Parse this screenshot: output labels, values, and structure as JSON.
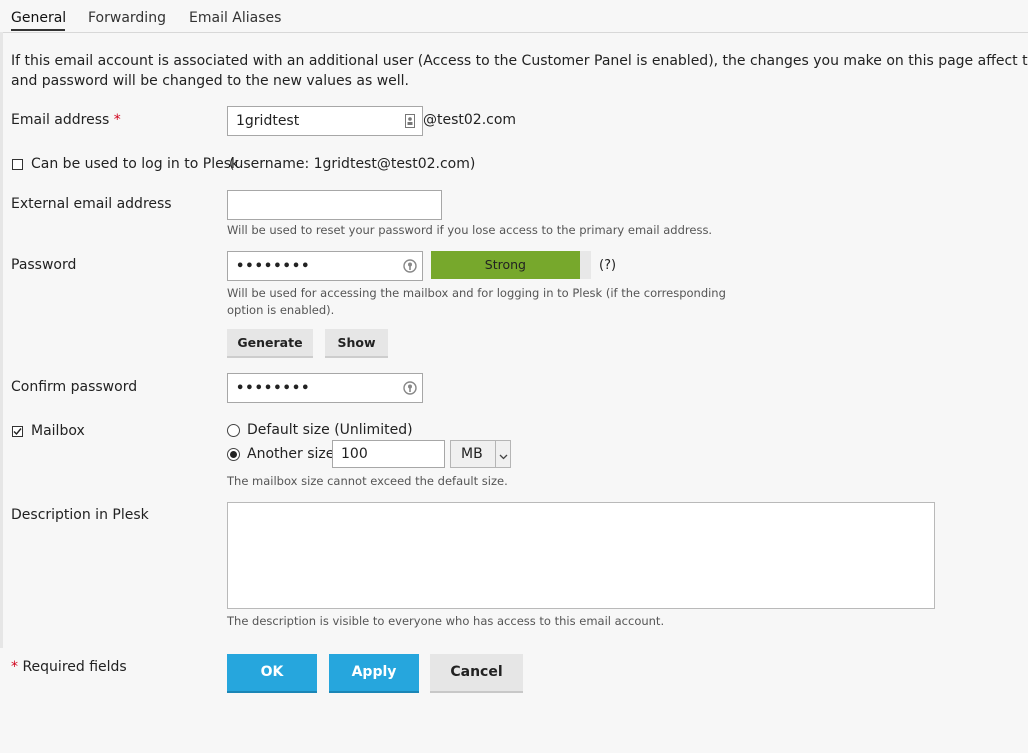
{
  "tabs": [
    {
      "label": "General",
      "active": true
    },
    {
      "label": "Forwarding",
      "active": false
    },
    {
      "label": "Email Aliases",
      "active": false
    }
  ],
  "intro_line1": "If this email account is associated with an additional user (Access to the Customer Panel is enabled), the changes you make on this page affect this user's set",
  "intro_line2": "and password will be changed to the new values as well.",
  "email": {
    "label": "Email address",
    "required_mark": "*",
    "value": "1gridtest",
    "domain": "@test02.com"
  },
  "login": {
    "checked": false,
    "label": "Can be used to log in to Plesk",
    "username_note": "(username: 1gridtest@test02.com)"
  },
  "external": {
    "label": "External email address",
    "value": "",
    "hint": "Will be used to reset your password if you lose access to the primary email address."
  },
  "password": {
    "label": "Password",
    "value": "••••••••",
    "strength_label": "Strong",
    "strength_fraction": 0.93,
    "help": "(?)",
    "hint_line1": "Will be used for accessing the mailbox and for logging in to Plesk (if the corresponding",
    "hint_line2": "option is enabled).",
    "generate_label": "Generate",
    "show_label": "Show"
  },
  "confirm": {
    "label": "Confirm password",
    "value": "••••••••"
  },
  "mailbox": {
    "checked": true,
    "label": "Mailbox",
    "default_option": "Default size (Unlimited)",
    "another_option": "Another size",
    "selected": "another",
    "size_value": "100",
    "unit": "MB",
    "hint": "The mailbox size cannot exceed the default size."
  },
  "description": {
    "label": "Description in Plesk",
    "value": "",
    "hint": "The description is visible to everyone who has access to this email account."
  },
  "footer": {
    "required_mark": "*",
    "required_text": "Required fields",
    "ok_label": "OK",
    "apply_label": "Apply",
    "cancel_label": "Cancel"
  },
  "colors": {
    "primary": "#26a6dd",
    "strong": "#77a82c",
    "required": "#d0021b"
  }
}
